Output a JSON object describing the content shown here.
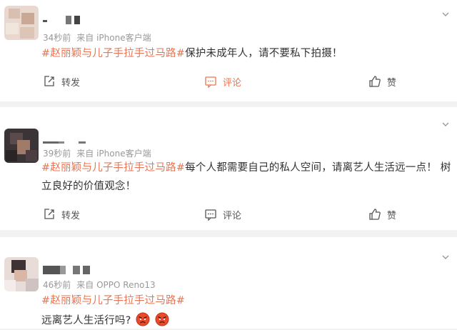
{
  "comments": [
    {
      "time": "34秒前",
      "source": "来自 iPhone客户端",
      "hashtag": "#赵丽颖与儿子手拉手过马路#",
      "text": "保护未成年人，请不要私下拍摄！",
      "actions": {
        "repost": "转发",
        "comment": "评论",
        "like": "赞"
      }
    },
    {
      "time": "39秒前",
      "source": "来自 iPhone客户端",
      "hashtag": "#赵丽颖与儿子手拉手过马路#",
      "text": "每个人都需要自己的私人空间，请离艺人生活远一点！ 树立良好的价值观念！",
      "actions": {
        "repost": "转发",
        "comment": "评论",
        "like": "赞"
      }
    },
    {
      "time": "46秒前",
      "source": "来自 OPPO Reno13",
      "hashtag": "#赵丽颖与儿子手拉手过马路#",
      "text": "远离艺人生活行吗?",
      "emoji": [
        "angry-face-emoji",
        "angry-face-emoji"
      ]
    }
  ],
  "colors": {
    "hashtag": "#eb7350",
    "meta": "#999999",
    "active_comment": "#eb7350",
    "background": "#f2f2f2"
  }
}
